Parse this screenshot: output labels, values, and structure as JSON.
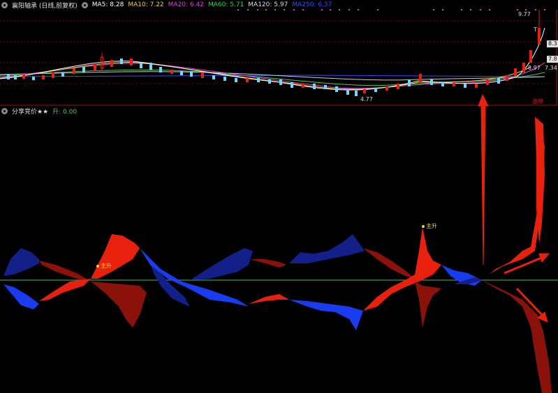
{
  "top_panel": {
    "title": "襄阳轴承 (日线,前复权)",
    "indicators": [
      {
        "label": "MA5: 8.28",
        "color": "#ffffff"
      },
      {
        "label": "MA10: 7.22",
        "color": "#f5d142"
      },
      {
        "label": "MA20: 6.42",
        "color": "#e040e0"
      },
      {
        "label": "MA60: 5.71",
        "color": "#3ccf4e"
      },
      {
        "label": "MA120: 5.97",
        "color": "#dddddd"
      },
      {
        "label": "MA250: 6.37",
        "color": "#3a4bff"
      }
    ],
    "price_labels": {
      "high": "9.77",
      "low": "4.77",
      "box1": "8.3",
      "box2": "7.8",
      "lvl1": "8.97",
      "lvl2": "7.34",
      "mark_t": "T"
    },
    "bottom_tag": "涨停"
  },
  "bottom_panel": {
    "title": "分享竞价★★",
    "value_label": "升: 0.00",
    "annotations": [
      "主升",
      "主升"
    ]
  },
  "colors": {
    "red": "#e8210f",
    "dark_red": "#8a120b",
    "blue": "#1a3cf0",
    "navy": "#13208a",
    "zero_line": "#2f9e3f",
    "grid": "#6e0d0d"
  }
}
